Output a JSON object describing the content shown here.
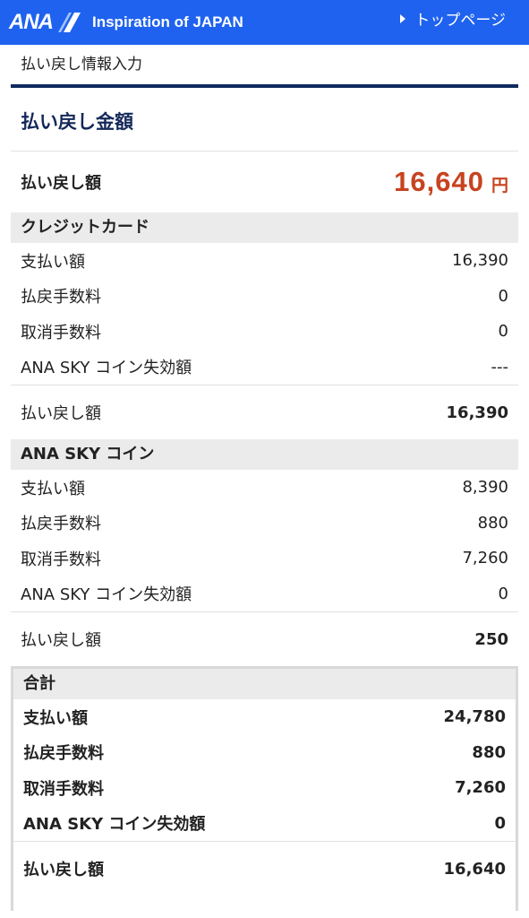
{
  "header": {
    "logo_text": "ANA",
    "tagline": "Inspiration of JAPAN",
    "top_link": "トップページ",
    "brand_color": "#1f62ef"
  },
  "breadcrumb": "払い戻し情報入力",
  "section_title": "払い戻し金額",
  "refund_total": {
    "label": "払い戻し額",
    "value": "16,640",
    "unit": "円",
    "color": "#c8431f"
  },
  "credit_card": {
    "title": "クレジットカード",
    "rows": [
      {
        "label": "支払い額",
        "value": "16,390"
      },
      {
        "label": "払戻手数料",
        "value": "0"
      },
      {
        "label": "取消手数料",
        "value": "0"
      },
      {
        "label": "ANA SKY コイン失効額",
        "value": "---"
      }
    ],
    "refund": {
      "label": "払い戻し額",
      "value": "16,390"
    }
  },
  "sky_coin": {
    "title": "ANA SKY コイン",
    "rows": [
      {
        "label": "支払い額",
        "value": "8,390"
      },
      {
        "label": "払戻手数料",
        "value": "880"
      },
      {
        "label": "取消手数料",
        "value": "7,260"
      },
      {
        "label": "ANA SKY コイン失効額",
        "value": "0"
      }
    ],
    "refund": {
      "label": "払い戻し額",
      "value": "250"
    }
  },
  "summary": {
    "title": "合計",
    "rows": [
      {
        "label": "支払い額",
        "value": "24,780"
      },
      {
        "label": "払戻手数料",
        "value": "880"
      },
      {
        "label": "取消手数料",
        "value": "7,260"
      },
      {
        "label": "ANA SKY コイン失効額",
        "value": "0"
      }
    ],
    "refund": {
      "label": "払い戻し額",
      "value": "16,640"
    }
  }
}
